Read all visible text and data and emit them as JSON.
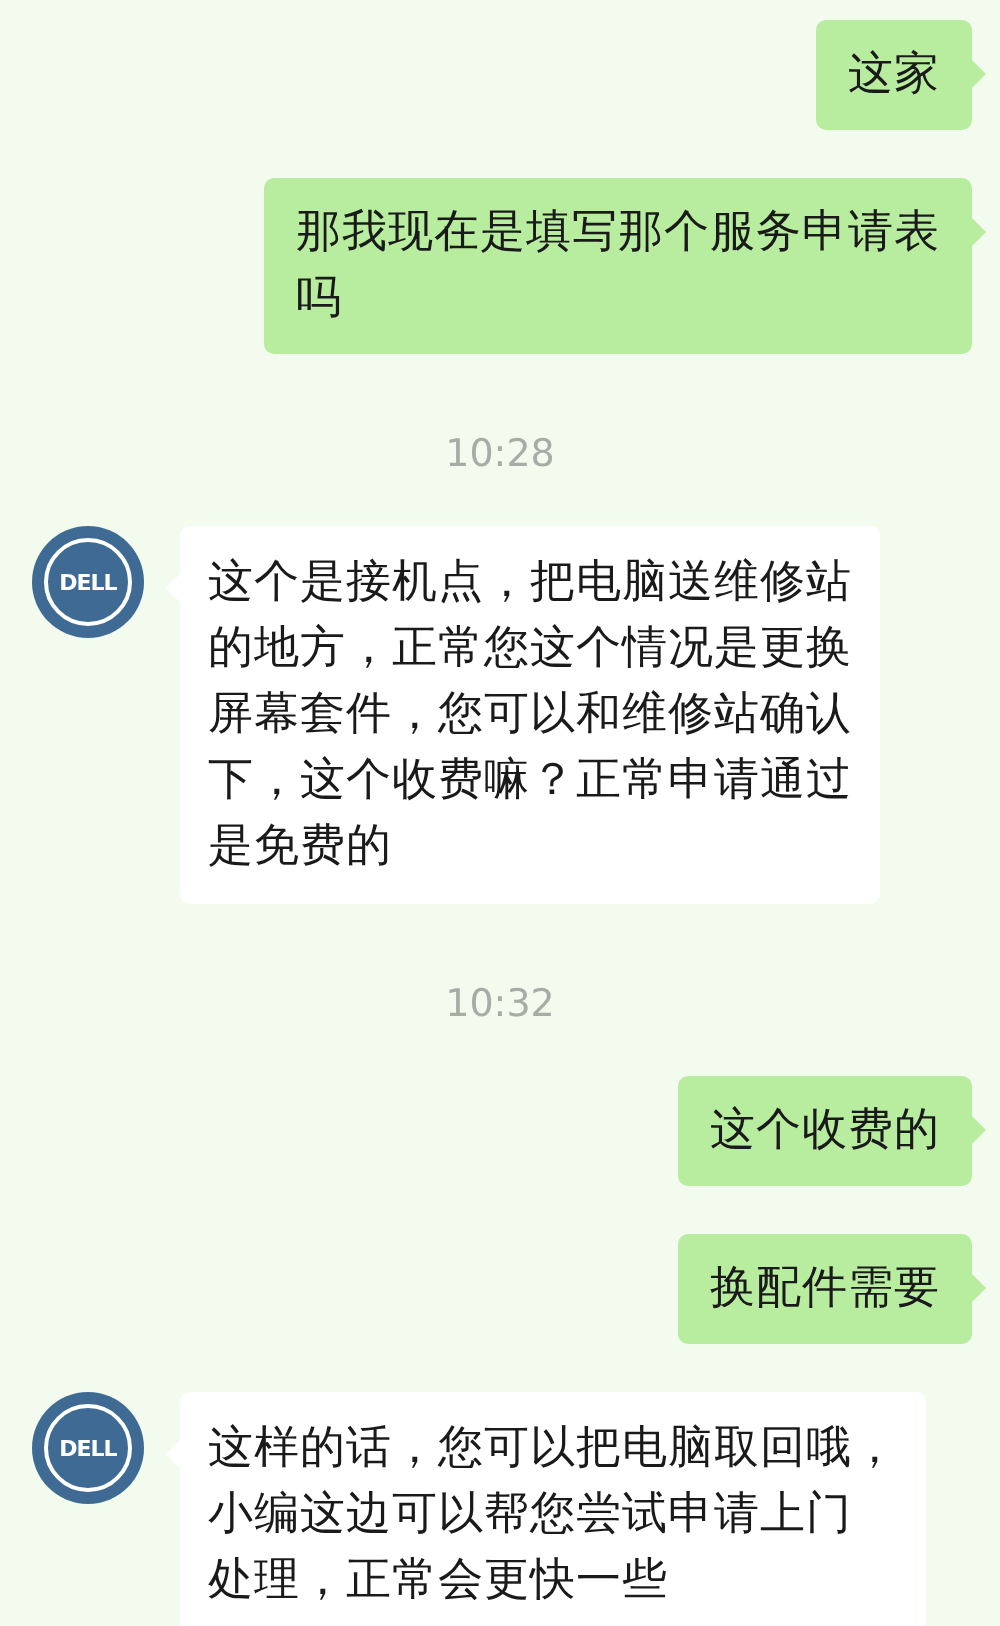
{
  "messages": [
    {
      "kind": "sent",
      "lines": [
        "这家"
      ]
    },
    {
      "kind": "sent",
      "lines": [
        "那我现在是填写那个服务申请表",
        "吗"
      ]
    },
    {
      "kind": "time",
      "text": "10:28"
    },
    {
      "kind": "received",
      "avatar_text": "DELL",
      "lines": [
        "这个是接机点，把电脑送维修站",
        "的地方，正常您这个情况是更换",
        "屏幕套件，您可以和维修站确认",
        "下，这个收费嘛？正常申请通过",
        "是免费的"
      ]
    },
    {
      "kind": "time",
      "text": "10:32"
    },
    {
      "kind": "sent",
      "lines": [
        "这个收费的"
      ]
    },
    {
      "kind": "sent",
      "lines": [
        "换配件需要"
      ]
    },
    {
      "kind": "received",
      "avatar_text": "DELL",
      "lines": [
        "这样的话，您可以把电脑取回哦，",
        "小编这边可以帮您尝试申请上门",
        "处理，正常会更快一些"
      ]
    }
  ]
}
